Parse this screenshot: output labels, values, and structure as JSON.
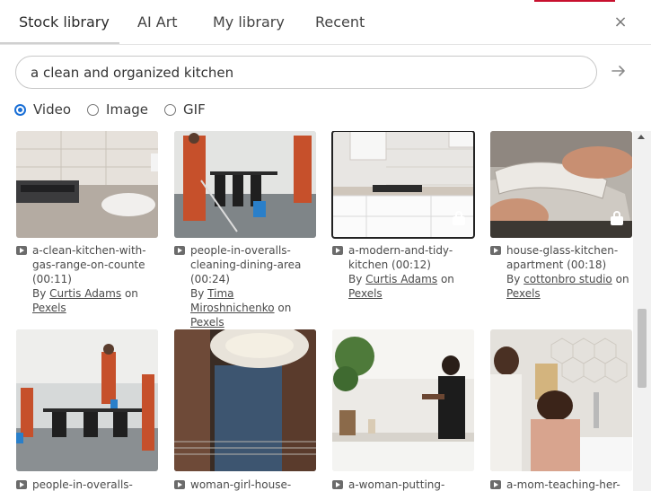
{
  "tabs": [
    {
      "label": "Stock library"
    },
    {
      "label": "AI Art"
    },
    {
      "label": "My library"
    },
    {
      "label": "Recent"
    }
  ],
  "close_glyph": "×",
  "search": {
    "value": "a clean and organized kitchen"
  },
  "media_types": [
    {
      "label": "Video",
      "checked": true
    },
    {
      "label": "Image",
      "checked": false
    },
    {
      "label": "GIF",
      "checked": false
    }
  ],
  "results": [
    {
      "title": "a-clean-kitchen-with-gas-range-on-counte",
      "duration": "(00:11)",
      "by": "By",
      "author": "Curtis Adams",
      "on": "on",
      "source": "Pexels"
    },
    {
      "title": "people-in-overalls-cleaning-dining-area",
      "duration": "(00:24)",
      "by": "By",
      "author": "Tima Miroshnichenko",
      "on": "on",
      "source": "Pexels"
    },
    {
      "title": "a-modern-and-tidy-kitchen",
      "duration": "(00:12)",
      "by": "By",
      "author": "Curtis Adams",
      "on": "on",
      "source": "Pexels"
    },
    {
      "title": "house-glass-kitchen-apartment",
      "duration": "(00:18)",
      "by": "By",
      "author": "cottonbro studio",
      "on": "on",
      "source": "Pexels"
    },
    {
      "title": "people-in-overalls-"
    },
    {
      "title": "woman-girl-house-glass"
    },
    {
      "title": "a-woman-putting-away-"
    },
    {
      "title": "a-mom-teaching-her-"
    }
  ],
  "colors": {
    "accent": "#1a6fd6",
    "brand_bar": "#c8102e"
  },
  "icons": [
    "close-icon",
    "arrow-right-icon",
    "video-icon",
    "lock-icon",
    "scroll-up-icon"
  ]
}
